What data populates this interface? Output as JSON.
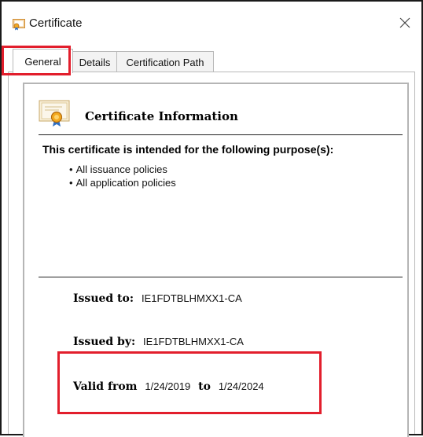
{
  "window": {
    "title": "Certificate",
    "icon": "certificate-icon",
    "close_icon": "close-icon"
  },
  "tabs": [
    {
      "label": "General",
      "active": true
    },
    {
      "label": "Details",
      "active": false
    },
    {
      "label": "Certification Path",
      "active": false
    }
  ],
  "general": {
    "heading": "Certificate Information",
    "purpose_heading": "This certificate is intended for the following purpose(s):",
    "purposes": [
      "All issuance policies",
      "All application policies"
    ],
    "issued_to_label": "Issued to:",
    "issued_to_value": "IE1FDTBLHMXX1-CA",
    "issued_by_label": "Issued by:",
    "issued_by_value": "IE1FDTBLHMXX1-CA",
    "valid_from_label": "Valid from",
    "valid_from_value": "1/24/2019",
    "valid_to_label": "to",
    "valid_to_value": "1/24/2024"
  },
  "colors": {
    "highlight": "#e21e2c",
    "border": "#b5b5b5"
  }
}
